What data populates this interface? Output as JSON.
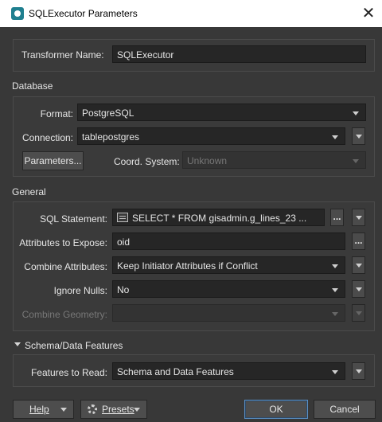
{
  "window": {
    "title": "SQLExecutor Parameters",
    "close_glyph": "✕"
  },
  "transformer": {
    "label": "Transformer Name:",
    "value": "SQLExecutor"
  },
  "database": {
    "title": "Database",
    "format_label": "Format:",
    "format_value": "PostgreSQL",
    "connection_label": "Connection:",
    "connection_value": "tablepostgres",
    "parameters_button": "Parameters...",
    "coord_label": "Coord. System:",
    "coord_value": "Unknown"
  },
  "general": {
    "title": "General",
    "sql_label": "SQL Statement:",
    "sql_value": "SELECT * FROM gisadmin.g_lines_23  ...",
    "attributes_label": "Attributes to Expose:",
    "attributes_value": "oid",
    "combine_label": "Combine Attributes:",
    "combine_value": "Keep Initiator Attributes if Conflict",
    "nulls_label": "Ignore Nulls:",
    "nulls_value": "No",
    "geometry_label": "Combine Geometry:",
    "geometry_value": "",
    "ellipsis": "..."
  },
  "schema": {
    "title": "Schema/Data Features",
    "features_label": "Features to Read:",
    "features_value": "Schema and Data Features"
  },
  "footer": {
    "help": "Help",
    "presets": "Presets",
    "ok": "OK",
    "cancel": "Cancel"
  },
  "colors": {
    "background": "#383838",
    "field": "#262626",
    "accent_border": "#5a8fc4"
  }
}
